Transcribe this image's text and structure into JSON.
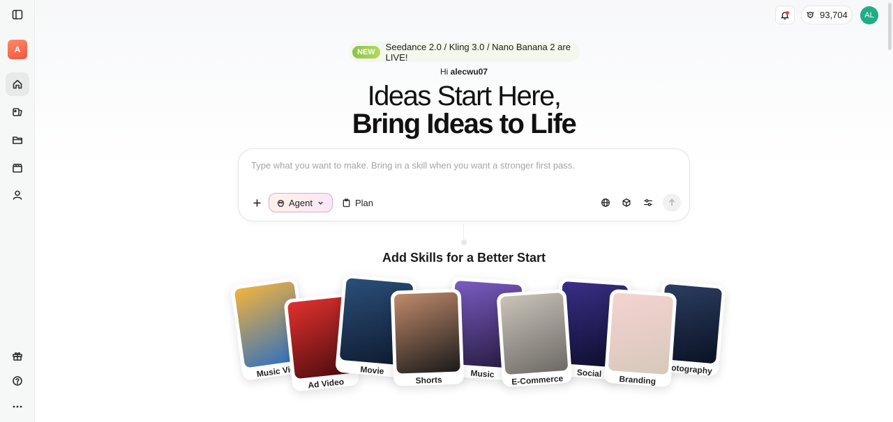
{
  "sidebar": {
    "toggle_icon": "sidebar-toggle-icon",
    "workspace_initial": "A",
    "nav": [
      {
        "name": "home",
        "icon": "home-icon",
        "active": true
      },
      {
        "name": "gallery",
        "icon": "gallery-icon"
      },
      {
        "name": "folder",
        "icon": "folder-icon"
      },
      {
        "name": "clapperboard",
        "icon": "clapperboard-icon"
      },
      {
        "name": "profile",
        "icon": "user-icon"
      }
    ],
    "bottom": [
      {
        "name": "gift",
        "icon": "gift-icon"
      },
      {
        "name": "help",
        "icon": "help-icon"
      },
      {
        "name": "more",
        "icon": "more-icon"
      }
    ]
  },
  "header": {
    "credits": "93,704",
    "user_initials": "AL",
    "avatar_color": "#1fad88"
  },
  "announcement": {
    "badge": "NEW",
    "text": "Seedance 2.0 / Kling 3.0 / Nano Banana 2 are LIVE!"
  },
  "greeting": {
    "prefix": "Hi",
    "username": "alecwu07"
  },
  "hero": {
    "line1": "Ideas Start Here,",
    "line2": "Bring Ideas to Life"
  },
  "prompt": {
    "placeholder": "Type what you want to make. Bring in a skill when you want a stronger first pass.",
    "mode_label": "Agent",
    "plan_label": "Plan"
  },
  "skills": {
    "title": "Add Skills for a Better Start",
    "cards": [
      {
        "label": "Music Vid",
        "colors": [
          "#f2b33d",
          "#2a6ec4"
        ]
      },
      {
        "label": "Ad Video",
        "colors": [
          "#e0312e",
          "#4b0b0e"
        ]
      },
      {
        "label": "Movie",
        "colors": [
          "#2b4f7a",
          "#0e1a2e"
        ]
      },
      {
        "label": "Shorts",
        "colors": [
          "#c08a6a",
          "#1a1a1a"
        ]
      },
      {
        "label": "Music",
        "colors": [
          "#7b5cc4",
          "#261a3e"
        ]
      },
      {
        "label": "E-Commerce",
        "colors": [
          "#c9c3b8",
          "#6d6a66"
        ]
      },
      {
        "label": "Social",
        "colors": [
          "#3b2f8a",
          "#0d0d2a"
        ]
      },
      {
        "label": "Branding",
        "colors": [
          "#f4d3d0",
          "#d7c8bb"
        ]
      },
      {
        "label": "Photography",
        "colors": [
          "#2c3e62",
          "#0a1224"
        ]
      }
    ]
  }
}
